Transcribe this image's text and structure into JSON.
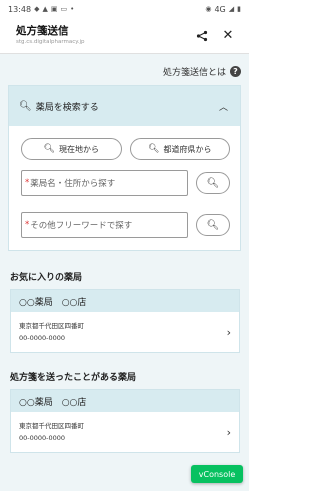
{
  "status": {
    "time": "13:48",
    "network": "4G"
  },
  "appbar": {
    "title": "処方箋送信",
    "subtitle": "stg.cs.digitalpharmacy.jp"
  },
  "about": {
    "label": "処方箋送信とは"
  },
  "search": {
    "header": "薬局を検索する",
    "current_location": "現在地から",
    "prefecture": "都道府県から",
    "name_field": {
      "required_mark": "*",
      "placeholder": "薬局名・住所から探す"
    },
    "freeword_field": {
      "required_mark": "*",
      "placeholder": "その他フリーワードで探す"
    }
  },
  "favorites": {
    "title": "お気に入りの薬局",
    "items": [
      {
        "name": "○○薬局　○○店",
        "address": "東京都千代田区四番町",
        "tel": "00-0000-0000"
      }
    ]
  },
  "sent": {
    "title": "処方箋を送ったことがある薬局",
    "items": [
      {
        "name": "○○薬局　○○店",
        "address": "東京都千代田区四番町",
        "tel": "00-0000-0000"
      }
    ]
  },
  "vconsole": {
    "label": "vConsole",
    "color": "#07c160"
  },
  "colors": {
    "panel_header": "#d7ebf0",
    "background": "#eef5f7"
  }
}
